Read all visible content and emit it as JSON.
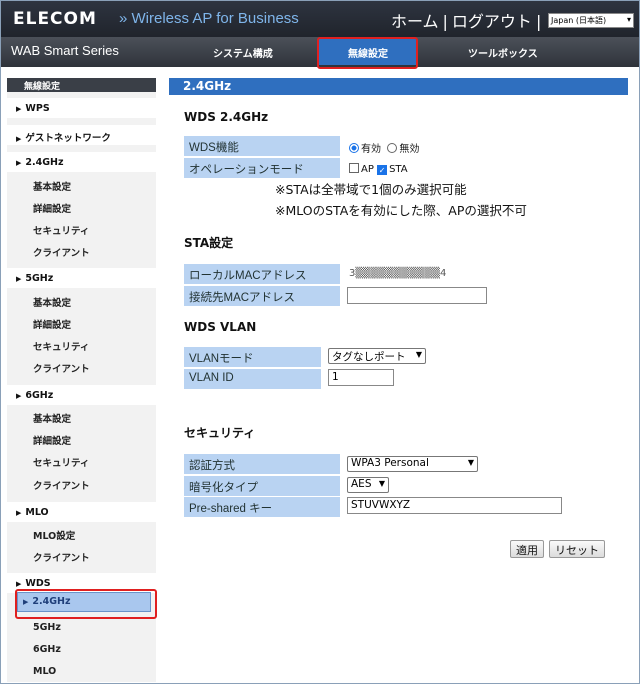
{
  "header": {
    "logo": "ELECOM",
    "product": "» Wireless AP for Business",
    "home": "ホーム",
    "logout": "ログアウト",
    "language": "Japan (日本語)"
  },
  "nav": {
    "series": "WAB Smart Series",
    "tabs": [
      "システム構成",
      "無線設定",
      "ツールボックス"
    ],
    "active_tab": "無線設定"
  },
  "sidebar": {
    "title": "無線設定",
    "items": [
      {
        "label": "WPS",
        "type": "section"
      },
      {
        "label": "ゲストネットワーク",
        "type": "section"
      },
      {
        "label": "2.4GHz",
        "type": "section"
      },
      {
        "label": "基本設定",
        "type": "sub"
      },
      {
        "label": "詳細設定",
        "type": "sub"
      },
      {
        "label": "セキュリティ",
        "type": "sub"
      },
      {
        "label": "クライアント",
        "type": "sub"
      },
      {
        "label": "5GHz",
        "type": "section"
      },
      {
        "label": "基本設定",
        "type": "sub"
      },
      {
        "label": "詳細設定",
        "type": "sub"
      },
      {
        "label": "セキュリティ",
        "type": "sub"
      },
      {
        "label": "クライアント",
        "type": "sub"
      },
      {
        "label": "6GHz",
        "type": "section"
      },
      {
        "label": "基本設定",
        "type": "sub"
      },
      {
        "label": "詳細設定",
        "type": "sub"
      },
      {
        "label": "セキュリティ",
        "type": "sub"
      },
      {
        "label": "クライアント",
        "type": "sub"
      },
      {
        "label": "MLO",
        "type": "section"
      },
      {
        "label": "MLO設定",
        "type": "sub"
      },
      {
        "label": "クライアント",
        "type": "sub"
      },
      {
        "label": "WDS",
        "type": "section"
      },
      {
        "label": "2.4GHz",
        "type": "active"
      },
      {
        "label": "5GHz",
        "type": "sub"
      },
      {
        "label": "6GHz",
        "type": "sub"
      },
      {
        "label": "MLO",
        "type": "sub"
      }
    ]
  },
  "main": {
    "title": "2.4GHz",
    "wds_section": "WDS 2.4GHz",
    "wds_function_label": "WDS機能",
    "wds_enabled": "有効",
    "wds_disabled": "無効",
    "operation_mode_label": "オペレーションモード",
    "mode_ap": "AP",
    "mode_sta": "STA",
    "note1": "※STAは全帯域で1個のみ選択可能",
    "note2": "※MLOのSTAを有効にした際、APの選択不可",
    "sta_section": "STA設定",
    "local_mac_label": "ローカルMACアドレス",
    "local_mac_value": "3▒▒▒▒▒▒▒▒▒▒▒4",
    "remote_mac_label": "接続先MACアドレス",
    "remote_mac_value": "",
    "vlan_section": "WDS VLAN",
    "vlan_mode_label": "VLANモード",
    "vlan_mode_value": "タグなしポート",
    "vlan_id_label": "VLAN ID",
    "vlan_id_value": "1",
    "security_section": "セキュリティ",
    "auth_label": "認証方式",
    "auth_value": "WPA3 Personal",
    "cipher_label": "暗号化タイプ",
    "cipher_value": "AES",
    "psk_label": "Pre-shared キー",
    "psk_value": "STUVWXYZ",
    "apply": "適用",
    "reset": "リセット"
  }
}
